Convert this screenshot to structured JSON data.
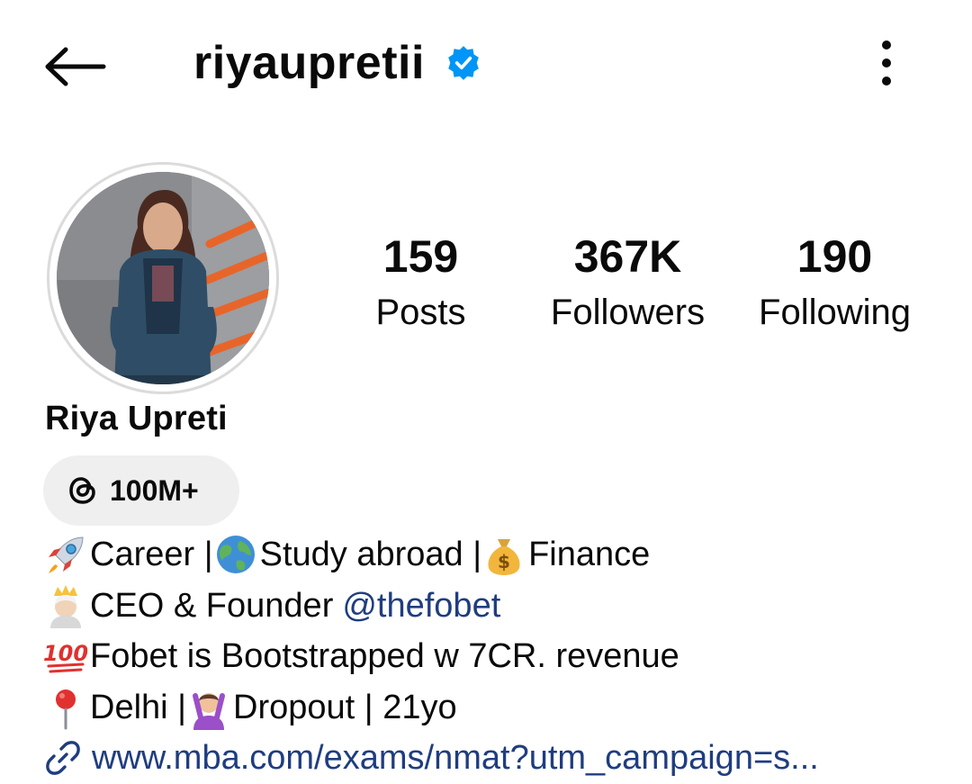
{
  "header": {
    "username": "riyaupretii"
  },
  "stats": {
    "posts": {
      "value": "159",
      "label": "Posts"
    },
    "followers": {
      "value": "367K",
      "label": "Followers"
    },
    "following": {
      "value": "190",
      "label": "Following"
    }
  },
  "profile": {
    "full_name": "Riya Upreti",
    "threads_count": "100M+"
  },
  "bio": {
    "line1": {
      "part1": "Career | ",
      "part2": "Study abroad | ",
      "part3": "Finance"
    },
    "line2": {
      "text": "CEO & Founder",
      "mention": "@thefobet"
    },
    "line3": {
      "text": "Fobet is Bootstrapped w 7CR. revenue"
    },
    "line4": {
      "part1": " Delhi |",
      "part2": "Dropout | 21yo"
    },
    "link": "www.mba.com/exams/nmat?utm_campaign=s..."
  },
  "colors": {
    "verified_blue": "#0095f6",
    "link_blue": "#1f3d80",
    "pill_bg": "#efefef"
  },
  "icons": [
    "back-arrow-icon",
    "verified-badge-icon",
    "more-vertical-icon",
    "threads-icon",
    "link-icon"
  ]
}
